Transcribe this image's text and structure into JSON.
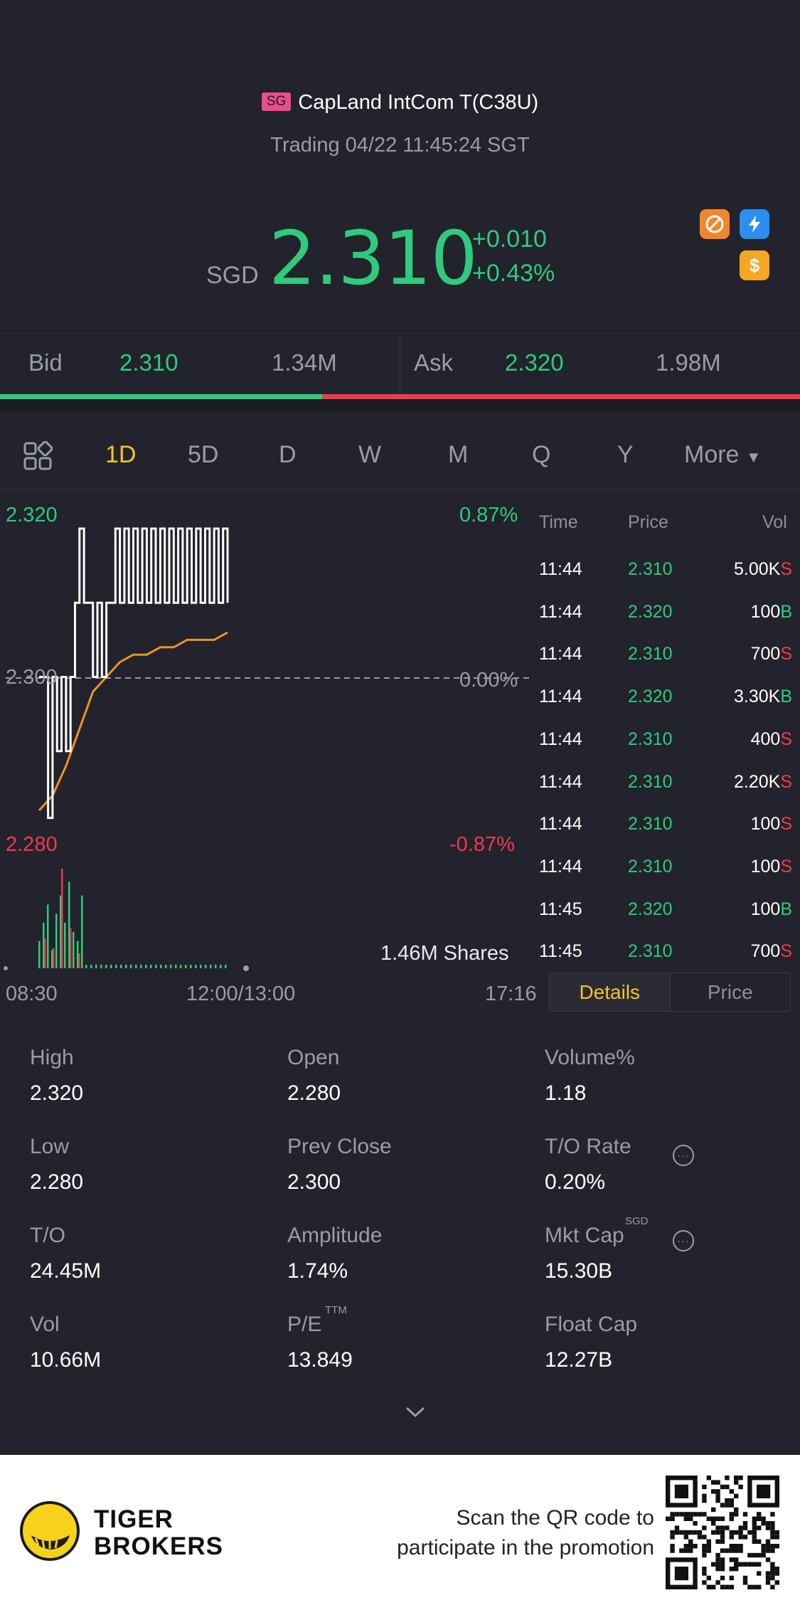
{
  "header": {
    "market_badge": "SG",
    "title": "CapLand IntCom T(C38U)",
    "status": "Trading 04/22 11:45:24 SGT"
  },
  "quote": {
    "currency": "SGD",
    "price": "2.310",
    "change": "+0.010",
    "change_pct": "+0.43%"
  },
  "badges": [
    "no-pattern-icon",
    "lightning-icon",
    "dollar-icon"
  ],
  "bidask": {
    "bid_label": "Bid",
    "bid_price": "2.310",
    "bid_size": "1.34M",
    "ask_label": "Ask",
    "ask_price": "2.320",
    "ask_size": "1.98M",
    "bid_share": 0.403
  },
  "periods": [
    "1D",
    "5D",
    "D",
    "W",
    "M",
    "Q",
    "Y",
    "More"
  ],
  "active_period": "1D",
  "chart_axes": {
    "y_high": "2.320",
    "y_mid": "2.300",
    "y_low": "2.280",
    "pct_high": "0.87%",
    "pct_mid": "0.00%",
    "pct_low": "-0.87%",
    "volume_label": "1.46M Shares",
    "x_start": "08:30",
    "x_mid": "12:00/13:00",
    "x_end": "17:16"
  },
  "chart_data": {
    "type": "line",
    "ylim": [
      2.28,
      2.32
    ],
    "reference": 2.3,
    "series": [],
    "price_path": [
      2.3,
      2.3,
      2.281,
      2.3,
      2.29,
      2.3,
      2.29,
      2.3,
      2.31,
      2.32,
      2.31,
      2.31,
      2.3,
      2.31,
      2.3,
      2.31,
      2.31,
      2.32,
      2.31,
      2.32,
      2.31,
      2.32,
      2.31,
      2.32,
      2.31,
      2.32,
      2.31,
      2.32,
      2.31,
      2.32,
      2.31,
      2.32,
      2.31,
      2.32,
      2.31,
      2.32,
      2.31,
      2.32,
      2.31,
      2.32,
      2.31,
      2.32,
      2.31
    ],
    "avg_path": [
      2.282,
      2.284,
      2.288,
      2.293,
      2.298,
      2.3,
      2.302,
      2.303,
      2.303,
      2.304,
      2.304,
      2.305,
      2.305,
      2.305,
      2.306
    ],
    "volume_green": [
      0.3,
      0.5,
      0.7,
      0.2,
      0.6,
      0.8,
      0.5,
      0.95,
      0.4,
      0.3,
      0.8
    ],
    "volume_red": [
      0.3,
      0.2,
      1.0,
      0.4,
      0.15
    ]
  },
  "trades_table": {
    "headers": [
      "Time",
      "Price",
      "Vol"
    ],
    "rows": [
      {
        "time": "11:44",
        "price": "2.310",
        "vol": "5.00K",
        "side": "S"
      },
      {
        "time": "11:44",
        "price": "2.320",
        "vol": "100",
        "side": "B"
      },
      {
        "time": "11:44",
        "price": "2.310",
        "vol": "700",
        "side": "S"
      },
      {
        "time": "11:44",
        "price": "2.320",
        "vol": "3.30K",
        "side": "B"
      },
      {
        "time": "11:44",
        "price": "2.310",
        "vol": "400",
        "side": "S"
      },
      {
        "time": "11:44",
        "price": "2.310",
        "vol": "2.20K",
        "side": "S"
      },
      {
        "time": "11:44",
        "price": "2.310",
        "vol": "100",
        "side": "S"
      },
      {
        "time": "11:44",
        "price": "2.310",
        "vol": "100",
        "side": "S"
      },
      {
        "time": "11:45",
        "price": "2.320",
        "vol": "100",
        "side": "B"
      },
      {
        "time": "11:45",
        "price": "2.310",
        "vol": "700",
        "side": "S"
      }
    ]
  },
  "toggle": {
    "details": "Details",
    "price": "Price"
  },
  "stats": [
    {
      "label": "High",
      "value": "2.320"
    },
    {
      "label": "Open",
      "value": "2.280"
    },
    {
      "label": "Volume%",
      "value": "1.18"
    },
    {
      "label": "Low",
      "value": "2.280"
    },
    {
      "label": "Prev Close",
      "value": "2.300"
    },
    {
      "label": "T/O Rate",
      "value": "0.20%"
    },
    {
      "label": "T/O",
      "value": "24.45M"
    },
    {
      "label": "Amplitude",
      "value": "1.74%"
    },
    {
      "label": "Mkt Cap",
      "value": "15.30B",
      "sup": "SGD"
    },
    {
      "label": "Vol",
      "value": "10.66M"
    },
    {
      "label": "P/E",
      "value": "13.849",
      "sup": "TTM"
    },
    {
      "label": "Float Cap",
      "value": "12.27B"
    }
  ],
  "footer": {
    "brand_line1": "TIGER",
    "brand_line2": "BROKERS",
    "promo_line1": "Scan the QR code to",
    "promo_line2": "participate in the promotion"
  },
  "colors": {
    "background": "#22232c",
    "up": "#2fcb7c",
    "down": "#f03a4e",
    "accent": "#f6c327",
    "avg_line": "#f0931e"
  }
}
